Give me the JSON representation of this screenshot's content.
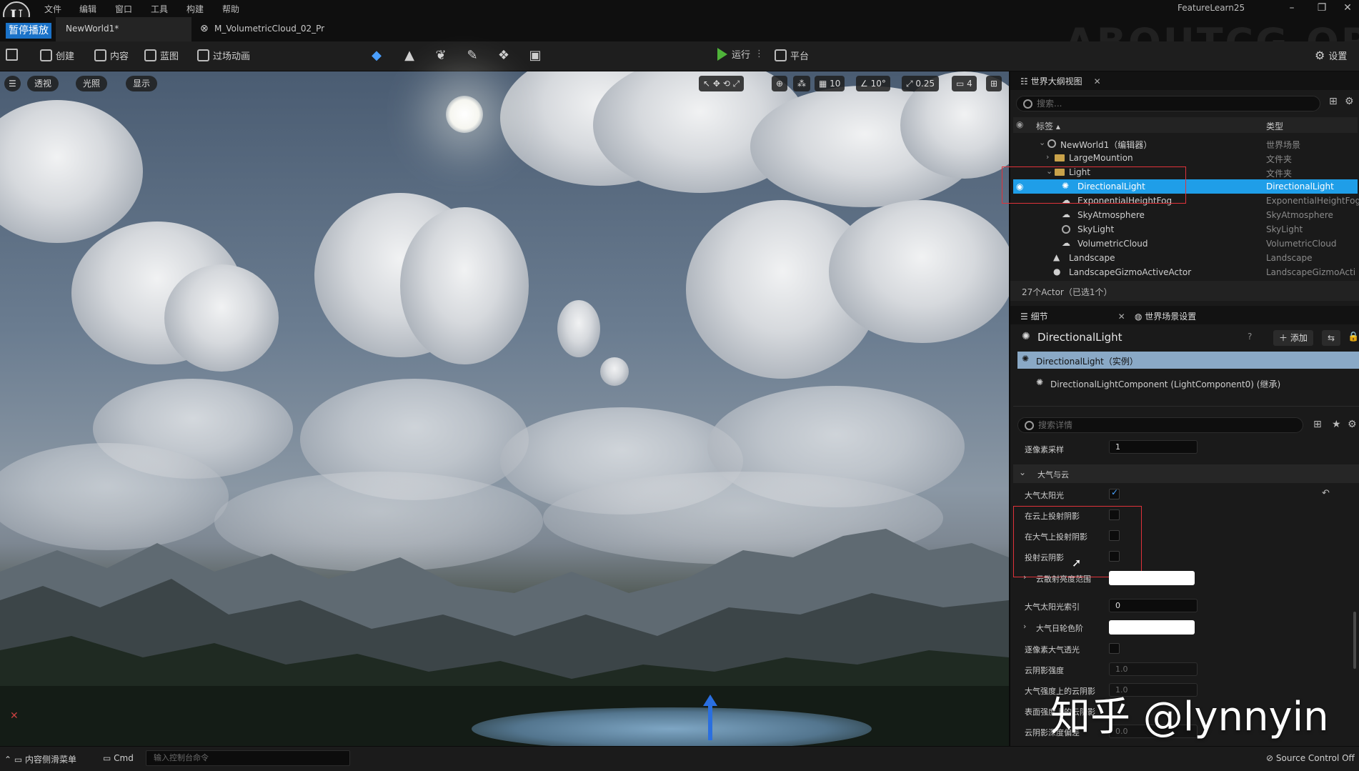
{
  "menu": {
    "items": [
      "文件",
      "编辑",
      "窗口",
      "工具",
      "构建",
      "帮助"
    ],
    "logo_text": "U",
    "project_name": "FeatureLearn25",
    "window_buttons": [
      "–",
      "❐",
      "✕"
    ]
  },
  "watermarks": {
    "top": "ABOUTCG.ORG",
    "zhihu": "知乎 @lynnyin"
  },
  "tabs": {
    "pause_badge": "暂停播放",
    "level_tab": "NewWorld1*",
    "material_tab": "M_VolumetricCloud_02_Pr"
  },
  "toolbar": {
    "create": "创建",
    "content": "内容",
    "blueprint": "蓝图",
    "cinematics": "过场动画",
    "play": "运行",
    "platform": "平台",
    "settings": "设置"
  },
  "viewport": {
    "menu_icon": "hamburger-icon",
    "perspective": "透视",
    "lighting": "光照",
    "show": "显示",
    "grid_snap": "10",
    "rotation_snap": "10°",
    "scale_snap": "0.25",
    "camera_speed": "4"
  },
  "outliner": {
    "tab_title": "世界大纲视图",
    "search_placeholder": "搜索...",
    "header_label": "标签 ▴",
    "header_type": "类型",
    "rows": [
      {
        "label": "NewWorld1（编辑器）",
        "type": "世界场景"
      },
      {
        "label": "LargeMountion",
        "type": "文件夹"
      },
      {
        "label": "Light",
        "type": "文件夹"
      },
      {
        "label": "DirectionalLight",
        "type": "DirectionalLight"
      },
      {
        "label": "ExponentialHeightFog",
        "type": "ExponentialHeightFog"
      },
      {
        "label": "SkyAtmosphere",
        "type": "SkyAtmosphere"
      },
      {
        "label": "SkyLight",
        "type": "SkyLight"
      },
      {
        "label": "VolumetricCloud",
        "type": "VolumetricCloud"
      },
      {
        "label": "Landscape",
        "type": "Landscape"
      },
      {
        "label": "LandscapeGizmoActiveActor",
        "type": "LandscapeGizmoActi"
      }
    ],
    "footer": "27个Actor（已选1个）"
  },
  "details": {
    "tab_title": "细节",
    "world_settings_tab": "世界场景设置",
    "actor_name": "DirectionalLight",
    "add_button": "添加",
    "instance_row": "DirectionalLight（实例）",
    "component_row": "DirectionalLightComponent (LightComponent0) (继承)",
    "search_placeholder": "搜索详情",
    "prev_prop_label": "逐像素采样",
    "prev_prop_value": "1",
    "section_title": "大气与云",
    "props": {
      "atmosphere_sun": "大气太阳光",
      "cast_on_cloud": "在云上投射阴影",
      "cast_on_atmosphere": "在大气上投射阴影",
      "cast_cloud_shadow": "投射云阴影",
      "cloud_scatter_range": "云散射亮度范围",
      "sun_index_label": "大气太阳光索引",
      "sun_index_value": "0",
      "disk_color": "大气日轮色阶",
      "per_pixel_transmittance": "逐像素大气透光",
      "cloud_shadow_strength": "云阴影强度",
      "cloud_shadow_strength_value": "1.0",
      "atmo_cloud_shadow": "大气强度上的云阴影",
      "atmo_cloud_shadow_value": "1.0",
      "surface_cloud_shadow": "表面强度上的云阴影",
      "cloud_shadow_depth_bias": "云阴影深度偏差",
      "cloud_shadow_depth_bias_value": "0.0"
    }
  },
  "bottombar": {
    "content_drawer": "内容侧滑菜单",
    "cmd": "Cmd",
    "console_placeholder": "输入控制台命令",
    "source_control": "Source Control Off"
  },
  "colors": {
    "selection": "#1f9ee8",
    "highlight_box": "#e0323a",
    "play_green": "#4fb33a",
    "pause_blue": "#1a72c8"
  }
}
